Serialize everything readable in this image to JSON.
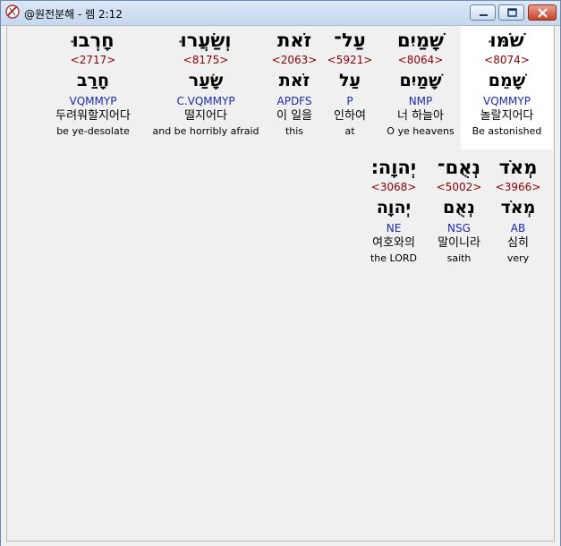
{
  "window": {
    "title": "@원전분해 - 렘 2:12"
  },
  "row1": [
    {
      "hebrew": "שֹׁמּוּ",
      "strong": "<8074>",
      "lemma": "שָׁמֵם",
      "parsing": "VQMMYP",
      "korean": "놀랄지어다",
      "english": "Be astonished"
    },
    {
      "hebrew": "שָׁמַיִם",
      "strong": "<8064>",
      "lemma": "שָׁמַיִם",
      "parsing": "NMP",
      "korean": "너 하늘아",
      "english": "O ye heavens"
    },
    {
      "hebrew": "עַל־",
      "strong": "<5921>",
      "lemma": "עַל",
      "parsing": "P",
      "korean": "인하여",
      "english": "at"
    },
    {
      "hebrew": "זֹאת",
      "strong": "<2063>",
      "lemma": "זֹאת",
      "parsing": "APDFS",
      "korean": "이 일을",
      "english": "this"
    },
    {
      "hebrew": "וְשַׂעֲרוּ",
      "strong": "<8175>",
      "lemma": "שָׂעַר",
      "parsing": "C.VQMMYP",
      "korean": "떨지어다",
      "english": "and be horribly afraid"
    },
    {
      "hebrew": "חָרְבוּ",
      "strong": "<2717>",
      "lemma": "חָרַב",
      "parsing": "VQMMYP",
      "korean": "두려워할지어다",
      "english": "be ye-desolate"
    }
  ],
  "row2": [
    {
      "hebrew": "מְאֹד",
      "strong": "<3966>",
      "lemma": "מְאֹד",
      "parsing": "AB",
      "korean": "심히",
      "english": "very"
    },
    {
      "hebrew": "נְאֻם־",
      "strong": "<5002>",
      "lemma": "נְאֻם",
      "parsing": "NSG",
      "korean": "말이니라",
      "english": "saith"
    },
    {
      "hebrew": "יְהוָה׃",
      "strong": "<3068>",
      "lemma": "יְהוָה",
      "parsing": "NE",
      "korean": "여호와의",
      "english": "the LORD"
    }
  ]
}
